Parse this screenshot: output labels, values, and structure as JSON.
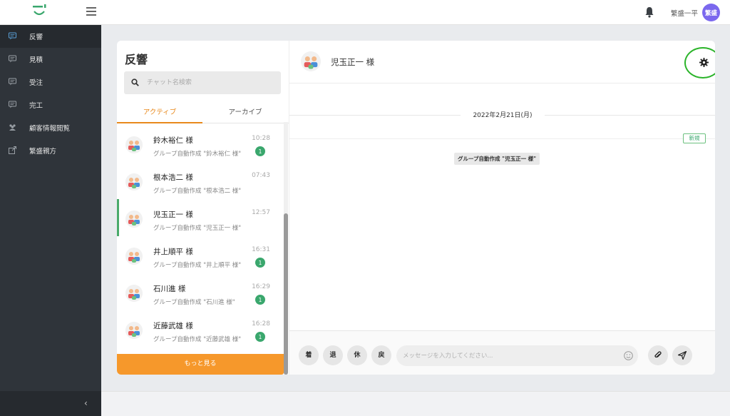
{
  "header": {
    "username": "繁盛一平",
    "avatar_text": "繁盛"
  },
  "sidebar": {
    "items": [
      {
        "label": "反響",
        "icon": "chat-icon",
        "active": true
      },
      {
        "label": "見積",
        "icon": "chat-icon",
        "active": false
      },
      {
        "label": "受注",
        "icon": "chat-icon",
        "active": false
      },
      {
        "label": "完工",
        "icon": "chat-icon",
        "active": false
      },
      {
        "label": "顧客情報閲覧",
        "icon": "users-icon",
        "active": false
      },
      {
        "label": "繁盛親方",
        "icon": "external-link-icon",
        "active": false
      }
    ],
    "collapse_glyph": "‹"
  },
  "chatlist": {
    "title": "反響",
    "search_placeholder": "チャット名検索",
    "tabs": [
      "アクティブ",
      "アーカイブ"
    ],
    "items": [
      {
        "name": "鈴木裕仁 様",
        "time": "10:28",
        "preview": "グループ自動作成 \"鈴木裕仁 様\"",
        "badge": "1"
      },
      {
        "name": "根本浩二 様",
        "time": "07:43",
        "preview": "グループ自動作成 \"根本浩二 様\"",
        "badge": ""
      },
      {
        "name": "児玉正一 様",
        "time": "12:57",
        "preview": "グループ自動作成 \"児玉正一 様\"",
        "badge": ""
      },
      {
        "name": "井上順平 様",
        "time": "16:31",
        "preview": "グループ自動作成 \"井上順平 様\"",
        "badge": "1"
      },
      {
        "name": "石川進 様",
        "time": "16:29",
        "preview": "グループ自動作成 \"石川進 様\"",
        "badge": "1"
      },
      {
        "name": "近藤武雄 様",
        "time": "16:28",
        "preview": "グループ自動作成 \"近藤武雄 様\"",
        "badge": "1"
      }
    ],
    "more_label": "もっと見る"
  },
  "chat": {
    "name": "児玉正一 様",
    "date": "2022年2月21日(月)",
    "new_label": "新規",
    "system_message": "グループ自動作成 \"児玉正一 様\"",
    "quick_buttons": [
      "着",
      "退",
      "休",
      "戻"
    ],
    "input_placeholder": "メッセージを入力してください..."
  },
  "colors": {
    "accent": "#f6982b",
    "active_tab": "#e8891c",
    "badge": "#3aa76d",
    "sidebar": "#2f343a",
    "highlight_circle": "#2bb42a"
  }
}
